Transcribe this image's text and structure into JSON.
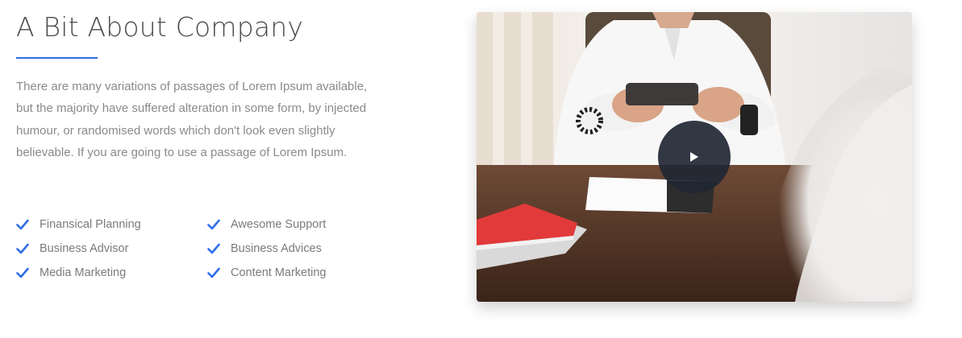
{
  "about": {
    "title": "A Bit About Company",
    "description": "There are many variations of passages of Lorem Ipsum available, but the majority have suffered alteration in some form, by injected humour, or randomised words which don't look even slightly believable. If you are going to use a passage of Lorem Ipsum.",
    "accent_color": "#2f6ee6",
    "features": [
      {
        "label": "Finansical Planning",
        "icon": "check-icon"
      },
      {
        "label": "Awesome Support",
        "icon": "check-icon"
      },
      {
        "label": "Business Advisor",
        "icon": "check-icon"
      },
      {
        "label": "Business Advices",
        "icon": "check-icon"
      },
      {
        "label": "Media Marketing",
        "icon": "check-icon"
      },
      {
        "label": "Content Marketing",
        "icon": "check-icon"
      }
    ]
  },
  "video": {
    "thumbnail": "office-meeting-photo",
    "play_icon": "play-icon",
    "play_button_color": "#212634"
  }
}
